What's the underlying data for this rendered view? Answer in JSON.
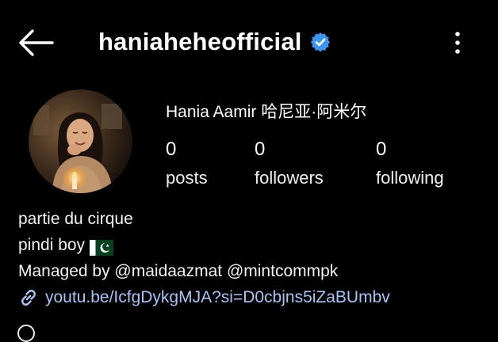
{
  "header": {
    "username": "haniaheheofficial",
    "back_icon": "arrow-left-icon",
    "verified_icon": "verified-badge-icon",
    "more_icon": "more-vertical-icon"
  },
  "profile": {
    "display_name": "Hania Aamir 哈尼亚·阿米尔",
    "avatar_icon": "profile-avatar"
  },
  "stats": [
    {
      "value": "0",
      "label": "posts"
    },
    {
      "value": "0",
      "label": "followers"
    },
    {
      "value": "0",
      "label": "following"
    }
  ],
  "bio": {
    "line1": "partie du cirque",
    "line2": "pindi boy",
    "line2_flag_icon": "pakistan-flag-icon",
    "line3": "Managed by @maidaazmat @mintcommpk",
    "link": "youtu.be/IcfgDykgMJA?si=D0cbjns5iZaBUmbv",
    "link_icon": "link-icon"
  },
  "colors": {
    "background": "#000000",
    "text": "#f5f5f5",
    "verified": "#3b96f3",
    "link": "#a7c4f7"
  }
}
